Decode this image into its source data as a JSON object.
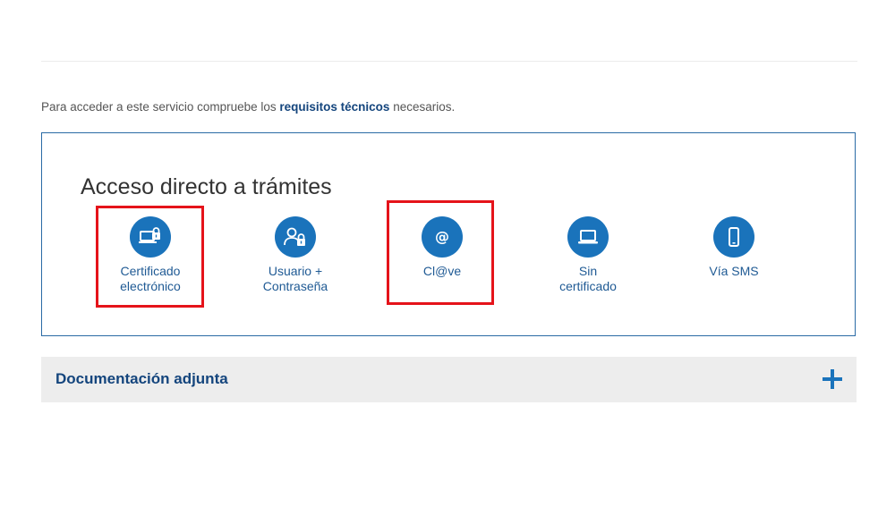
{
  "intro": {
    "prefix": "Para acceder a este servicio compruebe los ",
    "link": "requisitos técnicos",
    "suffix": " necesarios."
  },
  "access": {
    "title": "Acceso directo a trámites",
    "options": [
      {
        "icon": "certificate-lock-icon",
        "line1": "Certificado",
        "line2": "electrónico",
        "highlighted": true
      },
      {
        "icon": "user-lock-icon",
        "line1": "Usuario +",
        "line2": "Contraseña",
        "highlighted": false
      },
      {
        "icon": "at-sign-icon",
        "line1": "Cl@ve",
        "line2": "",
        "highlighted": true
      },
      {
        "icon": "laptop-icon",
        "line1": "Sin",
        "line2": "certificado",
        "highlighted": false
      },
      {
        "icon": "mobile-phone-icon",
        "line1": "Vía SMS",
        "line2": "",
        "highlighted": false
      }
    ]
  },
  "documentation": {
    "title": "Documentación adjunta",
    "expand_icon": "plus-icon"
  },
  "colors": {
    "brand_blue": "#1a73bb",
    "link_navy": "#14457d",
    "highlight_red": "#e5131a",
    "panel_gray": "#ededed"
  }
}
